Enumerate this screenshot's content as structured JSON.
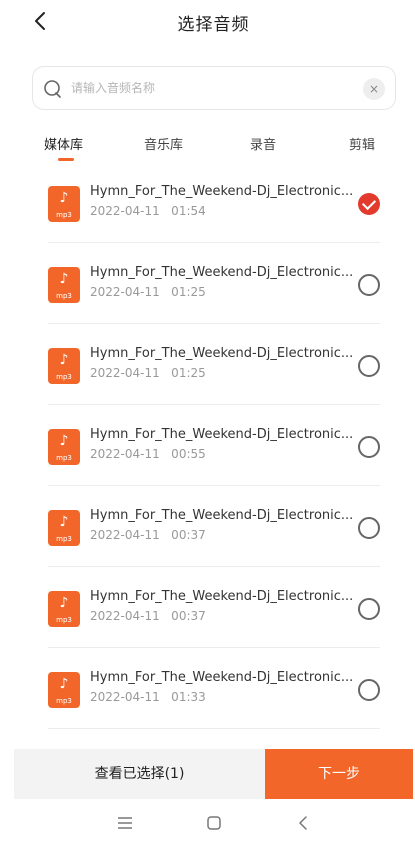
{
  "header": {
    "title": "选择音频"
  },
  "search": {
    "placeholder": "请输入音频名称",
    "value": "",
    "clear_label": "×"
  },
  "tabs": [
    {
      "label": "媒体库",
      "active": true
    },
    {
      "label": "音乐库",
      "active": false
    },
    {
      "label": "录音",
      "active": false
    },
    {
      "label": "剪辑",
      "active": false
    }
  ],
  "file_icon": {
    "glyph": "♪",
    "ext": "mp3"
  },
  "items": [
    {
      "name": "Hymn_For_The_Weekend-Dj_Electronic...",
      "date": "2022-04-11   01:54",
      "selected": true
    },
    {
      "name": "Hymn_For_The_Weekend-Dj_Electronic...",
      "date": "2022-04-11   01:25",
      "selected": false
    },
    {
      "name": "Hymn_For_The_Weekend-Dj_Electronic...",
      "date": "2022-04-11   01:25",
      "selected": false
    },
    {
      "name": "Hymn_For_The_Weekend-Dj_Electronic...",
      "date": "2022-04-11   00:55",
      "selected": false
    },
    {
      "name": "Hymn_For_The_Weekend-Dj_Electronic...",
      "date": "2022-04-11   00:37",
      "selected": false
    },
    {
      "name": "Hymn_For_The_Weekend-Dj_Electronic...",
      "date": "2022-04-11   00:37",
      "selected": false
    },
    {
      "name": "Hymn_For_The_Weekend-Dj_Electronic...",
      "date": "2022-04-11   01:33",
      "selected": false
    }
  ],
  "footer": {
    "view_selected_label": "查看已选择(1)",
    "next_label": "下一步"
  },
  "colors": {
    "accent": "#f2662a",
    "check": "#e23b2e"
  }
}
